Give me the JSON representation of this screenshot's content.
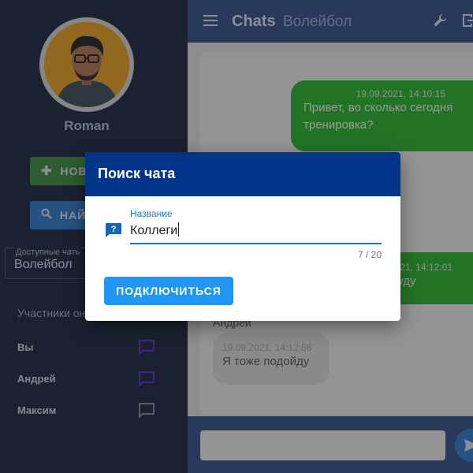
{
  "sidebar": {
    "user_name": "Roman",
    "new_button_label": "НОВ",
    "find_button_label": "НАЙ",
    "chats_select": {
      "label": "Доступные чать",
      "value": "Волейбол"
    },
    "members_title": "Участники он",
    "members": [
      {
        "name": "Вы",
        "icon": "chat-bubble-icon",
        "icon_color": "#5b2bd9"
      },
      {
        "name": "Андрей",
        "icon": "chat-bubble-icon",
        "icon_color": "#5b2bd9"
      },
      {
        "name": "Максим",
        "icon": "chat-bubble-icon",
        "icon_color": "#8a93a6"
      }
    ]
  },
  "topbar": {
    "title": "Chats",
    "subtitle": "Волейбол",
    "icons": [
      "menu-icon",
      "wrench-icon",
      "exit-icon"
    ]
  },
  "messages": [
    {
      "direction": "out",
      "time": "19.09.2021, 14:10:15",
      "text": "Привет, во сколько сегодня тренировка?"
    },
    {
      "direction": "out",
      "time": "21, 14:12:01",
      "text": "буду"
    },
    {
      "direction": "in",
      "sender": "Андрей",
      "time": "19.09.2021, 14:12:58",
      "text": "Я тоже подойду"
    }
  ],
  "composer": {
    "value": "",
    "send_icon": "send-icon"
  },
  "dialog": {
    "title": "Поиск чата",
    "field": {
      "label": "Название",
      "value": "Коллеги",
      "counter": "7 / 20",
      "icon": "help-icon"
    },
    "connect_label": "ПОДКЛЮЧИТЬСЯ"
  },
  "colors": {
    "sidebar_bg": "#17223f",
    "topbar_bg": "#304e8d",
    "dialog_header": "#003589",
    "accent": "#2196f3",
    "outgoing_bubble": "#24b92a"
  }
}
